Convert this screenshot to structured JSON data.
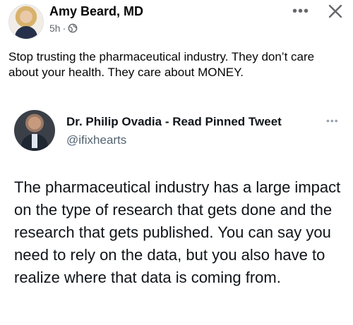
{
  "post": {
    "author": "Amy Beard, MD",
    "time": "5h",
    "separator": "·",
    "audience_icon": "globe-icon",
    "more_icon": "more-horizontal-icon",
    "close_icon": "close-icon",
    "text": "Stop trusting the pharmaceutical industry. They don’t care about your health. They care about MONEY."
  },
  "quoted_tweet": {
    "name": "Dr. Philip Ovadia - Read Pinned Tweet",
    "handle": "@ifixhearts",
    "more_icon": "more-horizontal-icon",
    "text": "The pharmaceutical industry has a large impact on the type of research that gets done and the research that gets published. You can say you need to rely on the data, but you also have to realize where that data is coming from."
  },
  "colors": {
    "primary_text": "#050505",
    "secondary_text": "#65676b",
    "twitter_text": "#0f1419",
    "twitter_secondary": "#536471"
  }
}
